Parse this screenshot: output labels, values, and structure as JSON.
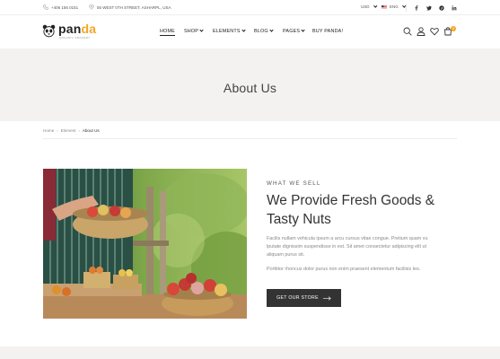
{
  "topbar": {
    "phone": "+406 156 0151",
    "address": "55 WEST 0TH STREET, ASHARPL, USA",
    "currency": "USD",
    "language": "ENG"
  },
  "header": {
    "logo": {
      "text_a": "pan",
      "text_b": "da",
      "tagline": "ORGANIC GROCERY"
    },
    "nav": {
      "home": "HOME",
      "shop": "SHOP",
      "elements": "ELEMENTS",
      "blog": "BLOG",
      "pages": "PAGES",
      "buy": "BUY PANDA!"
    },
    "cart_count": "0"
  },
  "page_title": "About Us",
  "breadcrumb": {
    "home": "Home",
    "element": "Element",
    "current": "About Us"
  },
  "content": {
    "eyebrow": "WHAT WE SELL",
    "heading": "We Provide Fresh Goods & Tasty Nuts",
    "paragraph_1": "Facilis nullam vehicula ipsum a arcu cursus vitae congue. Pretium quam vu lputate dignissim suspendisse in est. Sit amet consectetur adipiscing elit ut aliquam purus sit.",
    "paragraph_2": "Porttitor rhoncus dolor purus non enim praesent elementum facilisis leo.",
    "button_label": "GET OUR STORE"
  },
  "colors": {
    "accent": "#f5a623",
    "dark": "#333333",
    "band": "#f3f2f0"
  },
  "icons": [
    "phone-icon",
    "location-icon",
    "flag-icon",
    "facebook-icon",
    "twitter-icon",
    "pinterest-icon",
    "linkedin-icon",
    "search-icon",
    "user-icon",
    "heart-icon",
    "cart-icon",
    "arrow-right-icon"
  ]
}
